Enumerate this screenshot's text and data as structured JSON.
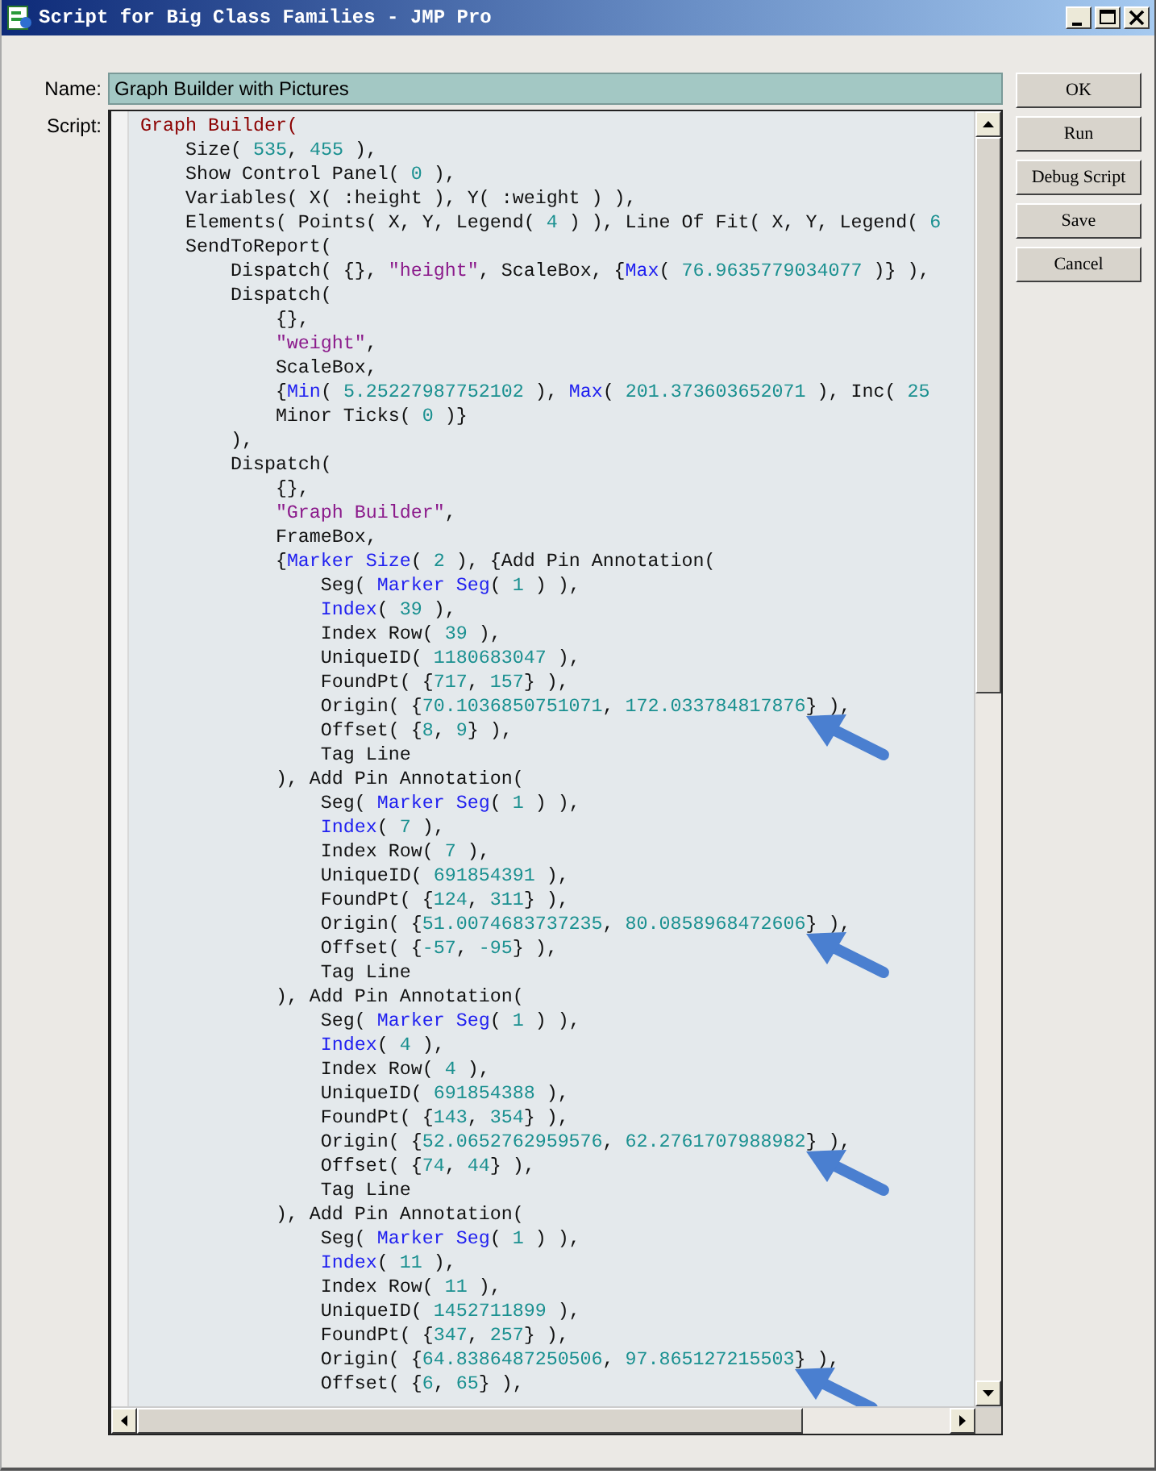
{
  "window": {
    "title": "Script for Big Class Families - JMP Pro"
  },
  "name_field": {
    "label": "Name:",
    "value": "Graph Builder with Pictures"
  },
  "script_label": "Script:",
  "buttons": [
    "OK",
    "Run",
    "Debug Script",
    "Save",
    "Cancel"
  ],
  "script_lines": [
    {
      "marked": false,
      "segments": [
        {
          "kind": "head",
          "text": "Graph Builder("
        }
      ]
    },
    {
      "marked": false,
      "segments": [
        {
          "kind": "plain",
          "text": "    Size( "
        },
        {
          "kind": "number",
          "text": "535"
        },
        {
          "kind": "plain",
          "text": ", "
        },
        {
          "kind": "number",
          "text": "455"
        },
        {
          "kind": "plain",
          "text": " ),"
        }
      ]
    },
    {
      "marked": false,
      "segments": [
        {
          "kind": "plain",
          "text": "    Show Control Panel( "
        },
        {
          "kind": "number",
          "text": "0"
        },
        {
          "kind": "plain",
          "text": " ),"
        }
      ]
    },
    {
      "marked": false,
      "segments": [
        {
          "kind": "plain",
          "text": "    Variables( X( :height ), Y( :weight ) ),"
        }
      ]
    },
    {
      "marked": false,
      "segments": [
        {
          "kind": "plain",
          "text": "    Elements( Points( X, Y, Legend( "
        },
        {
          "kind": "number",
          "text": "4"
        },
        {
          "kind": "plain",
          "text": " ) ), Line Of Fit( X, Y, Legend( "
        },
        {
          "kind": "number",
          "text": "6"
        }
      ]
    },
    {
      "marked": false,
      "segments": [
        {
          "kind": "plain",
          "text": "    SendToReport("
        }
      ]
    },
    {
      "marked": false,
      "segments": [
        {
          "kind": "plain",
          "text": "        Dispatch( {}, "
        },
        {
          "kind": "string",
          "text": "\"height\""
        },
        {
          "kind": "plain",
          "text": ", ScaleBox, {"
        },
        {
          "kind": "keyword",
          "text": "Max"
        },
        {
          "kind": "plain",
          "text": "( "
        },
        {
          "kind": "number",
          "text": "76.9635779034077"
        },
        {
          "kind": "plain",
          "text": " )} ),"
        }
      ]
    },
    {
      "marked": false,
      "segments": [
        {
          "kind": "plain",
          "text": "        Dispatch("
        }
      ]
    },
    {
      "marked": false,
      "segments": [
        {
          "kind": "plain",
          "text": "            {},"
        }
      ]
    },
    {
      "marked": false,
      "segments": [
        {
          "kind": "string",
          "text": "            \"weight\""
        },
        {
          "kind": "plain",
          "text": ","
        }
      ]
    },
    {
      "marked": false,
      "segments": [
        {
          "kind": "plain",
          "text": "            ScaleBox,"
        }
      ]
    },
    {
      "marked": false,
      "segments": [
        {
          "kind": "plain",
          "text": "            {"
        },
        {
          "kind": "keyword",
          "text": "Min"
        },
        {
          "kind": "plain",
          "text": "( "
        },
        {
          "kind": "number",
          "text": "5.25227987752102"
        },
        {
          "kind": "plain",
          "text": " ), "
        },
        {
          "kind": "keyword",
          "text": "Max"
        },
        {
          "kind": "plain",
          "text": "( "
        },
        {
          "kind": "number",
          "text": "201.373603652071"
        },
        {
          "kind": "plain",
          "text": " ), Inc( "
        },
        {
          "kind": "number",
          "text": "25"
        }
      ]
    },
    {
      "marked": false,
      "segments": [
        {
          "kind": "plain",
          "text": "            Minor Ticks( "
        },
        {
          "kind": "number",
          "text": "0"
        },
        {
          "kind": "plain",
          "text": " )}"
        }
      ]
    },
    {
      "marked": false,
      "segments": [
        {
          "kind": "plain",
          "text": "        ),"
        }
      ]
    },
    {
      "marked": false,
      "segments": [
        {
          "kind": "plain",
          "text": "        Dispatch("
        }
      ]
    },
    {
      "marked": false,
      "segments": [
        {
          "kind": "plain",
          "text": "            {},"
        }
      ]
    },
    {
      "marked": false,
      "segments": [
        {
          "kind": "string",
          "text": "            \"Graph Builder\""
        },
        {
          "kind": "plain",
          "text": ","
        }
      ]
    },
    {
      "marked": false,
      "segments": [
        {
          "kind": "plain",
          "text": "            FrameBox,"
        }
      ]
    },
    {
      "marked": false,
      "segments": [
        {
          "kind": "plain",
          "text": "            {"
        },
        {
          "kind": "keyword",
          "text": "Marker Size"
        },
        {
          "kind": "plain",
          "text": "( "
        },
        {
          "kind": "number",
          "text": "2"
        },
        {
          "kind": "plain",
          "text": " ), {Add Pin Annotation("
        }
      ]
    },
    {
      "marked": false,
      "segments": [
        {
          "kind": "plain",
          "text": "                Seg( "
        },
        {
          "kind": "keyword",
          "text": "Marker Seg"
        },
        {
          "kind": "plain",
          "text": "( "
        },
        {
          "kind": "number",
          "text": "1"
        },
        {
          "kind": "plain",
          "text": " ) ),"
        }
      ]
    },
    {
      "marked": false,
      "segments": [
        {
          "kind": "keyword",
          "text": "                Index"
        },
        {
          "kind": "plain",
          "text": "( "
        },
        {
          "kind": "number",
          "text": "39"
        },
        {
          "kind": "plain",
          "text": " ),"
        }
      ]
    },
    {
      "marked": false,
      "segments": [
        {
          "kind": "plain",
          "text": "                Index Row( "
        },
        {
          "kind": "number",
          "text": "39"
        },
        {
          "kind": "plain",
          "text": " ),"
        }
      ]
    },
    {
      "marked": false,
      "segments": [
        {
          "kind": "plain",
          "text": "                UniqueID( "
        },
        {
          "kind": "number",
          "text": "1180683047"
        },
        {
          "kind": "plain",
          "text": " ),"
        }
      ]
    },
    {
      "marked": false,
      "segments": [
        {
          "kind": "plain",
          "text": "                FoundPt( {"
        },
        {
          "kind": "number",
          "text": "717"
        },
        {
          "kind": "plain",
          "text": ", "
        },
        {
          "kind": "number",
          "text": "157"
        },
        {
          "kind": "plain",
          "text": "} ),"
        }
      ]
    },
    {
      "marked": true,
      "segments": [
        {
          "kind": "plain",
          "text": "                Origin( {"
        },
        {
          "kind": "number",
          "text": "70.1036850751071"
        },
        {
          "kind": "plain",
          "text": ", "
        },
        {
          "kind": "number",
          "text": "172.033784817876"
        },
        {
          "kind": "plain",
          "text": "} ),"
        }
      ]
    },
    {
      "marked": false,
      "segments": [
        {
          "kind": "plain",
          "text": "                Offset( {"
        },
        {
          "kind": "number",
          "text": "8"
        },
        {
          "kind": "plain",
          "text": ", "
        },
        {
          "kind": "number",
          "text": "9"
        },
        {
          "kind": "plain",
          "text": "} ),"
        }
      ]
    },
    {
      "marked": false,
      "segments": [
        {
          "kind": "plain",
          "text": "                Tag Line"
        }
      ]
    },
    {
      "marked": false,
      "segments": [
        {
          "kind": "plain",
          "text": "            ), Add Pin Annotation("
        }
      ]
    },
    {
      "marked": false,
      "segments": [
        {
          "kind": "plain",
          "text": "                Seg( "
        },
        {
          "kind": "keyword",
          "text": "Marker Seg"
        },
        {
          "kind": "plain",
          "text": "( "
        },
        {
          "kind": "number",
          "text": "1"
        },
        {
          "kind": "plain",
          "text": " ) ),"
        }
      ]
    },
    {
      "marked": false,
      "segments": [
        {
          "kind": "keyword",
          "text": "                Index"
        },
        {
          "kind": "plain",
          "text": "( "
        },
        {
          "kind": "number",
          "text": "7"
        },
        {
          "kind": "plain",
          "text": " ),"
        }
      ]
    },
    {
      "marked": false,
      "segments": [
        {
          "kind": "plain",
          "text": "                Index Row( "
        },
        {
          "kind": "number",
          "text": "7"
        },
        {
          "kind": "plain",
          "text": " ),"
        }
      ]
    },
    {
      "marked": false,
      "segments": [
        {
          "kind": "plain",
          "text": "                UniqueID( "
        },
        {
          "kind": "number",
          "text": "691854391"
        },
        {
          "kind": "plain",
          "text": " ),"
        }
      ]
    },
    {
      "marked": false,
      "segments": [
        {
          "kind": "plain",
          "text": "                FoundPt( {"
        },
        {
          "kind": "number",
          "text": "124"
        },
        {
          "kind": "plain",
          "text": ", "
        },
        {
          "kind": "number",
          "text": "311"
        },
        {
          "kind": "plain",
          "text": "} ),"
        }
      ]
    },
    {
      "marked": true,
      "segments": [
        {
          "kind": "plain",
          "text": "                Origin( {"
        },
        {
          "kind": "number",
          "text": "51.0074683737235"
        },
        {
          "kind": "plain",
          "text": ", "
        },
        {
          "kind": "number",
          "text": "80.0858968472606"
        },
        {
          "kind": "plain",
          "text": "} ),"
        }
      ]
    },
    {
      "marked": false,
      "segments": [
        {
          "kind": "plain",
          "text": "                Offset( {"
        },
        {
          "kind": "number",
          "text": "-57"
        },
        {
          "kind": "plain",
          "text": ", "
        },
        {
          "kind": "number",
          "text": "-95"
        },
        {
          "kind": "plain",
          "text": "} ),"
        }
      ]
    },
    {
      "marked": false,
      "segments": [
        {
          "kind": "plain",
          "text": "                Tag Line"
        }
      ]
    },
    {
      "marked": false,
      "segments": [
        {
          "kind": "plain",
          "text": "            ), Add Pin Annotation("
        }
      ]
    },
    {
      "marked": false,
      "segments": [
        {
          "kind": "plain",
          "text": "                Seg( "
        },
        {
          "kind": "keyword",
          "text": "Marker Seg"
        },
        {
          "kind": "plain",
          "text": "( "
        },
        {
          "kind": "number",
          "text": "1"
        },
        {
          "kind": "plain",
          "text": " ) ),"
        }
      ]
    },
    {
      "marked": false,
      "segments": [
        {
          "kind": "keyword",
          "text": "                Index"
        },
        {
          "kind": "plain",
          "text": "( "
        },
        {
          "kind": "number",
          "text": "4"
        },
        {
          "kind": "plain",
          "text": " ),"
        }
      ]
    },
    {
      "marked": false,
      "segments": [
        {
          "kind": "plain",
          "text": "                Index Row( "
        },
        {
          "kind": "number",
          "text": "4"
        },
        {
          "kind": "plain",
          "text": " ),"
        }
      ]
    },
    {
      "marked": false,
      "segments": [
        {
          "kind": "plain",
          "text": "                UniqueID( "
        },
        {
          "kind": "number",
          "text": "691854388"
        },
        {
          "kind": "plain",
          "text": " ),"
        }
      ]
    },
    {
      "marked": false,
      "segments": [
        {
          "kind": "plain",
          "text": "                FoundPt( {"
        },
        {
          "kind": "number",
          "text": "143"
        },
        {
          "kind": "plain",
          "text": ", "
        },
        {
          "kind": "number",
          "text": "354"
        },
        {
          "kind": "plain",
          "text": "} ),"
        }
      ]
    },
    {
      "marked": true,
      "segments": [
        {
          "kind": "plain",
          "text": "                Origin( {"
        },
        {
          "kind": "number",
          "text": "52.0652762959576"
        },
        {
          "kind": "plain",
          "text": ", "
        },
        {
          "kind": "number",
          "text": "62.2761707988982"
        },
        {
          "kind": "plain",
          "text": "} ),"
        }
      ]
    },
    {
      "marked": false,
      "segments": [
        {
          "kind": "plain",
          "text": "                Offset( {"
        },
        {
          "kind": "number",
          "text": "74"
        },
        {
          "kind": "plain",
          "text": ", "
        },
        {
          "kind": "number",
          "text": "44"
        },
        {
          "kind": "plain",
          "text": "} ),"
        }
      ]
    },
    {
      "marked": false,
      "segments": [
        {
          "kind": "plain",
          "text": "                Tag Line"
        }
      ]
    },
    {
      "marked": false,
      "segments": [
        {
          "kind": "plain",
          "text": "            ), Add Pin Annotation("
        }
      ]
    },
    {
      "marked": false,
      "segments": [
        {
          "kind": "plain",
          "text": "                Seg( "
        },
        {
          "kind": "keyword",
          "text": "Marker Seg"
        },
        {
          "kind": "plain",
          "text": "( "
        },
        {
          "kind": "number",
          "text": "1"
        },
        {
          "kind": "plain",
          "text": " ) ),"
        }
      ]
    },
    {
      "marked": false,
      "segments": [
        {
          "kind": "keyword",
          "text": "                Index"
        },
        {
          "kind": "plain",
          "text": "( "
        },
        {
          "kind": "number",
          "text": "11"
        },
        {
          "kind": "plain",
          "text": " ),"
        }
      ]
    },
    {
      "marked": false,
      "segments": [
        {
          "kind": "plain",
          "text": "                Index Row( "
        },
        {
          "kind": "number",
          "text": "11"
        },
        {
          "kind": "plain",
          "text": " ),"
        }
      ]
    },
    {
      "marked": false,
      "segments": [
        {
          "kind": "plain",
          "text": "                UniqueID( "
        },
        {
          "kind": "number",
          "text": "1452711899"
        },
        {
          "kind": "plain",
          "text": " ),"
        }
      ]
    },
    {
      "marked": false,
      "segments": [
        {
          "kind": "plain",
          "text": "                FoundPt( {"
        },
        {
          "kind": "number",
          "text": "347"
        },
        {
          "kind": "plain",
          "text": ", "
        },
        {
          "kind": "number",
          "text": "257"
        },
        {
          "kind": "plain",
          "text": "} ),"
        }
      ]
    },
    {
      "marked": true,
      "segments": [
        {
          "kind": "plain",
          "text": "                Origin( {"
        },
        {
          "kind": "number",
          "text": "64.8386487250506"
        },
        {
          "kind": "plain",
          "text": ", "
        },
        {
          "kind": "number",
          "text": "97.865127215503"
        },
        {
          "kind": "plain",
          "text": "} ),"
        }
      ]
    },
    {
      "marked": false,
      "segments": [
        {
          "kind": "plain",
          "text": "                Offset( {"
        },
        {
          "kind": "number",
          "text": "6"
        },
        {
          "kind": "plain",
          "text": ", "
        },
        {
          "kind": "number",
          "text": "65"
        },
        {
          "kind": "plain",
          "text": "} ),"
        }
      ]
    }
  ]
}
